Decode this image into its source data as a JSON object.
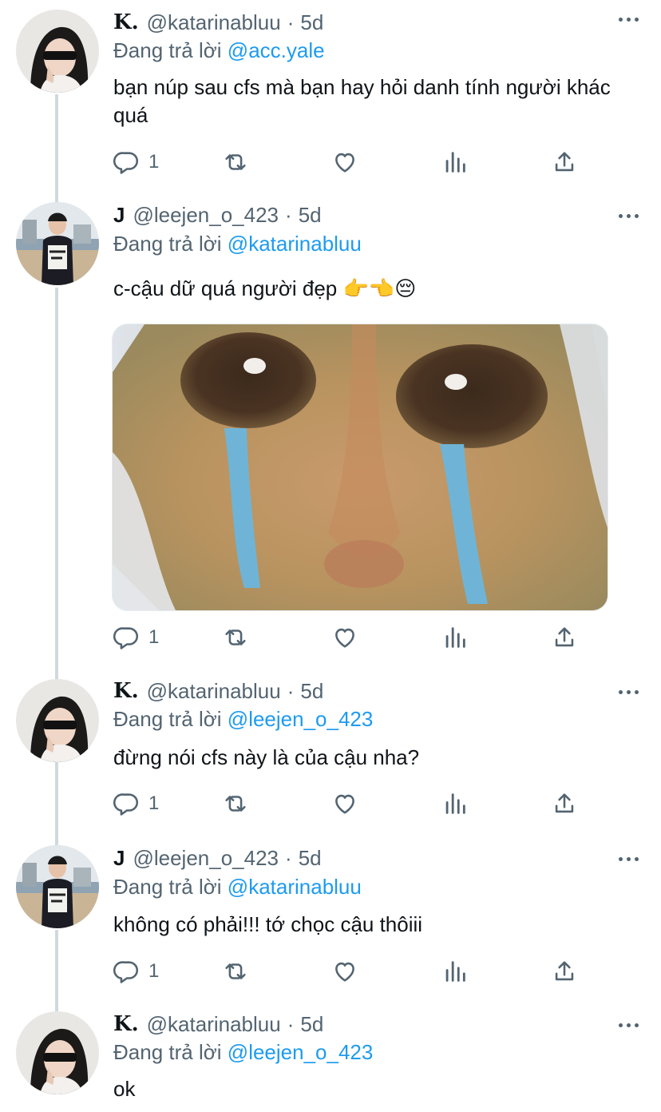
{
  "tweets": [
    {
      "name": "K.",
      "handle": "@katarinabluu",
      "separator": "·",
      "time": "5d",
      "replying_prefix": "Đang trả lời",
      "replying_to": "@acc.yale",
      "text": "bạn núp sau cfs mà bạn hay hỏi danh tính người khác quá",
      "reply_count": "1"
    },
    {
      "name": "J",
      "handle": "@leejen_o_423",
      "separator": "·",
      "time": "5d",
      "replying_prefix": "Đang trả lời",
      "replying_to": "@katarinabluu",
      "text": "c-cậu dữ quá người đẹp 👉👈😔",
      "reply_count": "1"
    },
    {
      "name": "K.",
      "handle": "@katarinabluu",
      "separator": "·",
      "time": "5d",
      "replying_prefix": "Đang trả lời",
      "replying_to": "@leejen_o_423",
      "text": "đừng nói cfs này là của cậu nha?",
      "reply_count": "1"
    },
    {
      "name": "J",
      "handle": "@leejen_o_423",
      "separator": "·",
      "time": "5d",
      "replying_prefix": "Đang trả lời",
      "replying_to": "@katarinabluu",
      "text": "không có phải!!! tớ chọc cậu thôiii",
      "reply_count": "1"
    },
    {
      "name": "K.",
      "handle": "@katarinabluu",
      "separator": "·",
      "time": "5d",
      "replying_prefix": "Đang trả lời",
      "replying_to": "@leejen_o_423",
      "text": "ok"
    }
  ],
  "colors": {
    "text": "#0f1419",
    "secondary": "#536471",
    "mention": "#1d9bf0",
    "thread_line": "#cfd9de"
  },
  "icons": [
    "reply-icon",
    "retweet-icon",
    "like-icon",
    "views-icon",
    "share-icon",
    "more-icon"
  ]
}
